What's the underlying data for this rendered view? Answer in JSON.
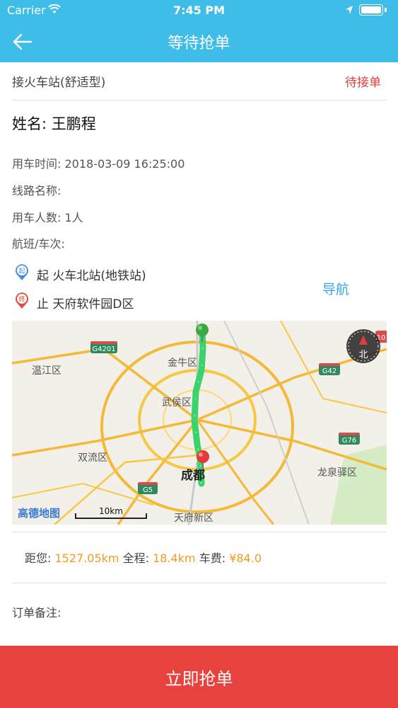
{
  "status_bar": {
    "carrier": "Carrier",
    "time": "7:45 PM"
  },
  "nav": {
    "title": "等待抢单"
  },
  "order": {
    "type": "接火车站(舒适型)",
    "status": "待接单",
    "name": "姓名: 王鹏程",
    "use_time": "用车时间: 2018-03-09 16:25:00",
    "route_name": "线路名称:",
    "passengers": "用车人数: 1人",
    "flight": "航班/车次:"
  },
  "route": {
    "start_marker": "起",
    "start_icon_char": "起",
    "start_place": "起  火车北站(地铁站)",
    "end_icon_char": "终",
    "end_place": "止  天府软件园D区",
    "nav_label": "导航"
  },
  "map": {
    "labels": {
      "wenjiang": "温江区",
      "jinniu": "金牛区",
      "wuhou": "武侯区",
      "shuangliu": "双流区",
      "chengdu": "成都",
      "longquanyi": "龙泉驿区",
      "tianfu": "天府新区",
      "logo": "高德地图",
      "scale": "10km",
      "compass": "北"
    },
    "shields": {
      "g4201": "G4201",
      "g42": "G42",
      "g76": "G76",
      "g5": "G5",
      "g10": "10"
    },
    "colors": {
      "route": "#3ad26a",
      "start": "#3aa843",
      "end": "#e53a3a",
      "highway": "#f5b938"
    }
  },
  "stats": {
    "distance_label": "距您:",
    "distance_value": "1527.05km",
    "total_label": "全程:",
    "total_value": "18.4km",
    "fare_label": "车费:",
    "fare_value": "¥84.0"
  },
  "remark": {
    "label": "订单备注:"
  },
  "action": {
    "grab_label": "立即抢单"
  }
}
